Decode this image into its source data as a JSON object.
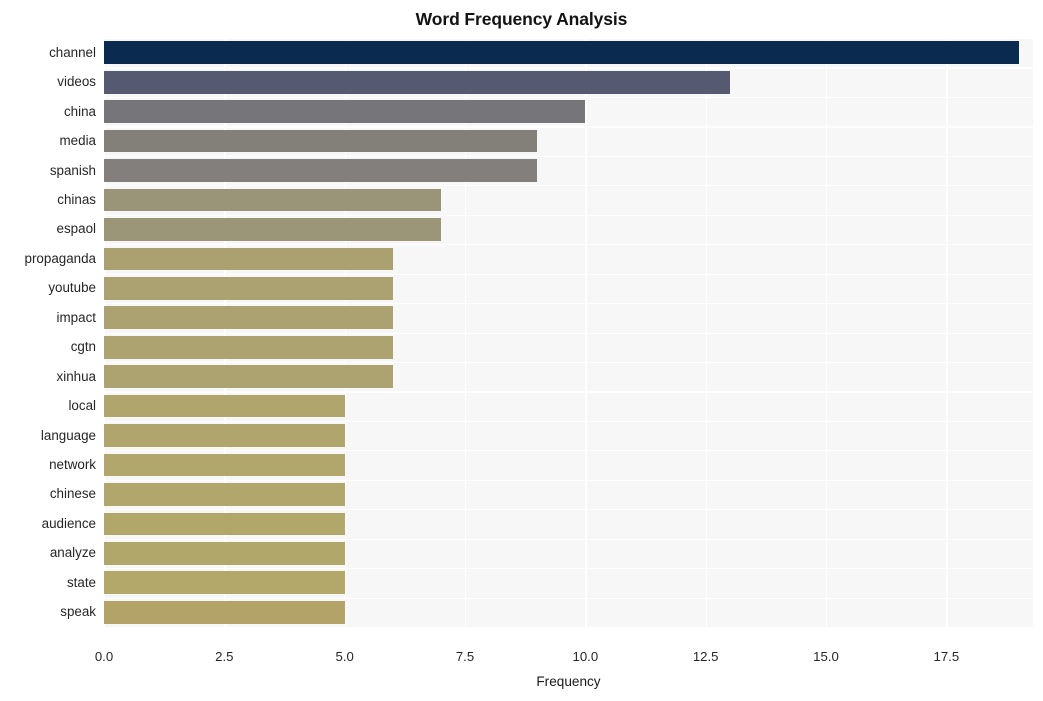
{
  "chart_data": {
    "type": "bar",
    "orientation": "horizontal",
    "title": "Word Frequency Analysis",
    "xlabel": "Frequency",
    "ylabel": "",
    "xlim": [
      0,
      19.3
    ],
    "xticks": [
      "0.0",
      "2.5",
      "5.0",
      "7.5",
      "10.0",
      "12.5",
      "15.0",
      "17.5"
    ],
    "xtick_values": [
      0,
      2.5,
      5,
      7.5,
      10,
      12.5,
      15,
      17.5
    ],
    "grid": true,
    "grid_color": "#ffffff",
    "plot_background": "#f7f7f7",
    "legend": null,
    "categories": [
      "channel",
      "videos",
      "china",
      "media",
      "spanish",
      "chinas",
      "espaol",
      "propaganda",
      "youtube",
      "impact",
      "cgtn",
      "xinhua",
      "local",
      "language",
      "network",
      "chinese",
      "audience",
      "analyze",
      "state",
      "speak"
    ],
    "values": [
      19,
      13,
      10,
      9,
      9,
      7,
      7,
      6,
      6,
      6,
      6,
      6,
      5,
      5,
      5,
      5,
      5,
      5,
      5,
      5
    ],
    "bar_colors": [
      "#0a2a50",
      "#555a70",
      "#76767a",
      "#828079",
      "#827f7c",
      "#9a9478",
      "#9c9679",
      "#aaa070",
      "#aca271",
      "#aca271",
      "#ada371",
      "#ada371",
      "#b0a56c",
      "#b0a56c",
      "#b1a66b",
      "#b1a66b",
      "#b2a76a",
      "#b2a76a",
      "#b3a869",
      "#b3a369"
    ]
  }
}
